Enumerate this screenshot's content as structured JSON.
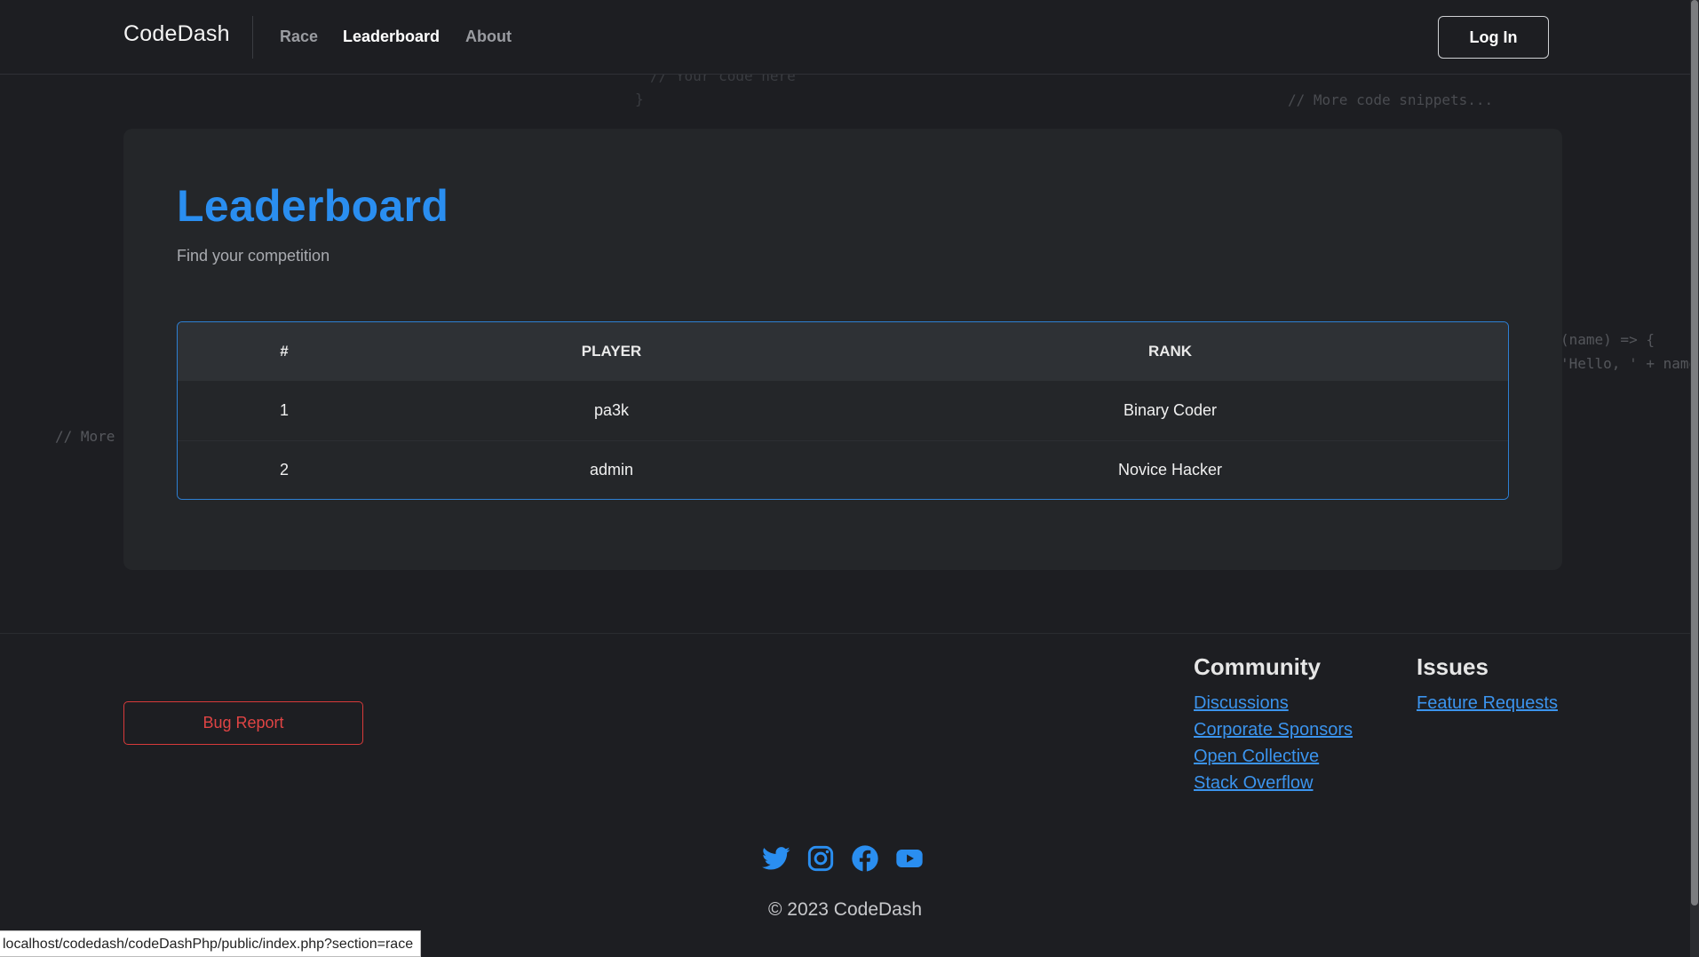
{
  "navbar": {
    "brand": "CodeDash",
    "links": [
      {
        "label": "Race",
        "active": false
      },
      {
        "label": "Leaderboard",
        "active": true
      },
      {
        "label": "About",
        "active": false
      }
    ],
    "login_label": "Log In"
  },
  "background_code": {
    "snippet_1": "// Your code here",
    "snippet_2": "}",
    "snippet_3": "// More code snippets...",
    "snippet_4": "(name) => {",
    "snippet_5": "'Hello, ' + name + '",
    "snippet_6": "// More code"
  },
  "leaderboard": {
    "title": "Leaderboard",
    "subtitle": "Find your competition",
    "columns": [
      "#",
      "PLAYER",
      "RANK"
    ],
    "rows": [
      {
        "num": "1",
        "player": "pa3k",
        "rank": "Binary Coder"
      },
      {
        "num": "2",
        "player": "admin",
        "rank": "Novice Hacker"
      }
    ]
  },
  "footer": {
    "bug_report_label": "Bug Report",
    "community": {
      "heading": "Community",
      "links": [
        "Discussions",
        "Corporate Sponsors",
        "Open Collective",
        "Stack Overflow"
      ]
    },
    "issues": {
      "heading": "Issues",
      "links": [
        "Feature Requests"
      ]
    },
    "socials": [
      "twitter-icon",
      "instagram-icon",
      "facebook-icon",
      "youtube-icon"
    ],
    "social_color": "#2a8ef0",
    "copyright": "© 2023 CodeDash"
  },
  "status_url": "localhost/codedash/codeDashPhp/public/index.php?section=race",
  "colors": {
    "accent": "#2a8ef0",
    "danger": "#e04444",
    "background": "#1d1e22",
    "card": "#242629"
  }
}
